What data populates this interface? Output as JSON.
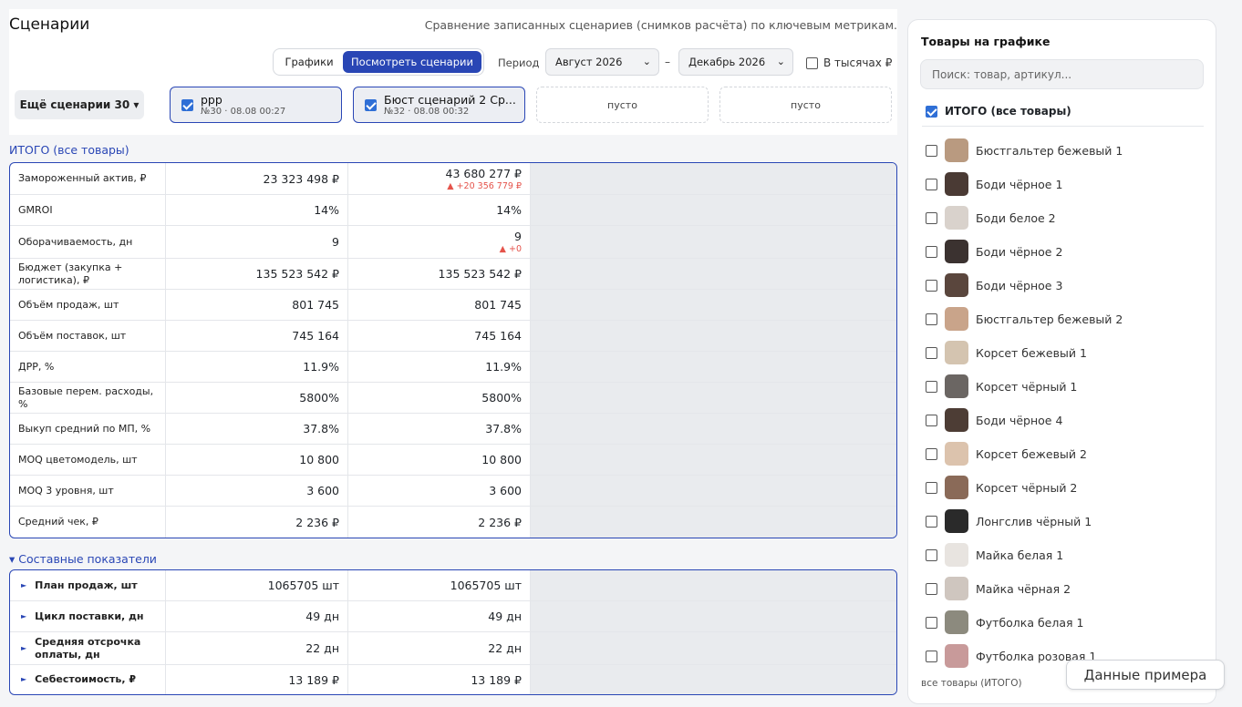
{
  "page": {
    "title": "Сценарии",
    "subtitle": "Сравнение записанных сценариев (снимков расчёта) по ключевым метрикам."
  },
  "toolbar": {
    "tab_charts": "Графики",
    "tab_scenarios": "Посмотреть сценарии",
    "period_label": "Период",
    "period_from": "Август 2026",
    "period_dash": "–",
    "period_to": "Декабрь 2026",
    "thousands_label": "В тысячах ₽",
    "thousands_checked": false
  },
  "scenarios": {
    "more_label": "Ещё сценарии 30 ▾",
    "cards": [
      {
        "name": "ррр",
        "meta": "№30 · 08.08 00:27",
        "checked": true
      },
      {
        "name": "Бюст сценарий 2 Ср...",
        "meta": "№32 · 08.08 00:32",
        "checked": true
      }
    ],
    "empty_label": "пусто"
  },
  "totals": {
    "label": "ИТОГО (все товары)",
    "rows": [
      {
        "name": "Замороженный актив, ₽",
        "v1": "23 323 498 ₽",
        "v2": "43 680 277 ₽",
        "d2": "▲ +20 356 779 ₽"
      },
      {
        "name": "GMROI",
        "v1": "14%",
        "v2": "14%",
        "d2": ""
      },
      {
        "name": "Оборачиваемость, дн",
        "v1": "9",
        "v2": "9",
        "d2": "▲ +0"
      },
      {
        "name": "Бюджет (закупка + логистика), ₽",
        "v1": "135 523 542 ₽",
        "v2": "135 523 542 ₽",
        "d2": ""
      },
      {
        "name": "Объём продаж, шт",
        "v1": "801 745",
        "v2": "801 745",
        "d2": ""
      },
      {
        "name": "Объём поставок, шт",
        "v1": "745 164",
        "v2": "745 164",
        "d2": ""
      },
      {
        "name": "ДРР, %",
        "v1": "11.9%",
        "v2": "11.9%",
        "d2": ""
      },
      {
        "name": "Базовые перем. расходы, %",
        "v1": "5800%",
        "v2": "5800%",
        "d2": ""
      },
      {
        "name": "Выкуп средний по МП, %",
        "v1": "37.8%",
        "v2": "37.8%",
        "d2": ""
      },
      {
        "name": "MOQ цветомодель, шт",
        "v1": "10 800",
        "v2": "10 800",
        "d2": ""
      },
      {
        "name": "MOQ 3 уровня, шт",
        "v1": "3 600",
        "v2": "3 600",
        "d2": ""
      },
      {
        "name": "Средний чек, ₽",
        "v1": "2 236 ₽",
        "v2": "2 236 ₽",
        "d2": ""
      }
    ]
  },
  "composite": {
    "label": "▾ Составные показатели",
    "rows": [
      {
        "name": "План продаж, шт",
        "v1": "1065705 шт",
        "v2": "1065705 шт"
      },
      {
        "name": "Цикл поставки, дн",
        "v1": "49 дн",
        "v2": "49 дн"
      },
      {
        "name": "Средняя отсрочка оплаты, дн",
        "v1": "22 дн",
        "v2": "22 дн"
      },
      {
        "name": "Себестоимость, ₽",
        "v1": "13 189 ₽",
        "v2": "13 189 ₽"
      }
    ]
  },
  "products_panel": {
    "title": "Товары на графике",
    "search_placeholder": "Поиск: товар, артикул...",
    "total_label": "ИТОГО (все товары)",
    "total_checked": true,
    "items": [
      {
        "name": "Бюстгальтер бежевый 1",
        "color": "#b99a80"
      },
      {
        "name": "Боди чёрное 1",
        "color": "#4a3a34"
      },
      {
        "name": "Боди белое 2",
        "color": "#d9d2cc"
      },
      {
        "name": "Боди чёрное 2",
        "color": "#3b3230"
      },
      {
        "name": "Боди чёрное 3",
        "color": "#5a463d"
      },
      {
        "name": "Бюстгальтер бежевый 2",
        "color": "#c9a48a"
      },
      {
        "name": "Корсет бежевый 1",
        "color": "#d4c4b0"
      },
      {
        "name": "Корсет чёрный 1",
        "color": "#6b6663"
      },
      {
        "name": "Боди чёрное 4",
        "color": "#4d3d35"
      },
      {
        "name": "Корсет бежевый 2",
        "color": "#dcc3ad"
      },
      {
        "name": "Корсет чёрный 2",
        "color": "#8a6a58"
      },
      {
        "name": "Лонгслив чёрный 1",
        "color": "#2a2a2a"
      },
      {
        "name": "Майка белая 1",
        "color": "#e8e4e0"
      },
      {
        "name": "Майка чёрная 2",
        "color": "#cfc6bf"
      },
      {
        "name": "Футболка белая 1",
        "color": "#8c8a7e"
      },
      {
        "name": "Футболка розовая 1",
        "color": "#c89a9a"
      }
    ],
    "footer": "все товары (ИТОГО)"
  },
  "example_button": "Данные примера"
}
